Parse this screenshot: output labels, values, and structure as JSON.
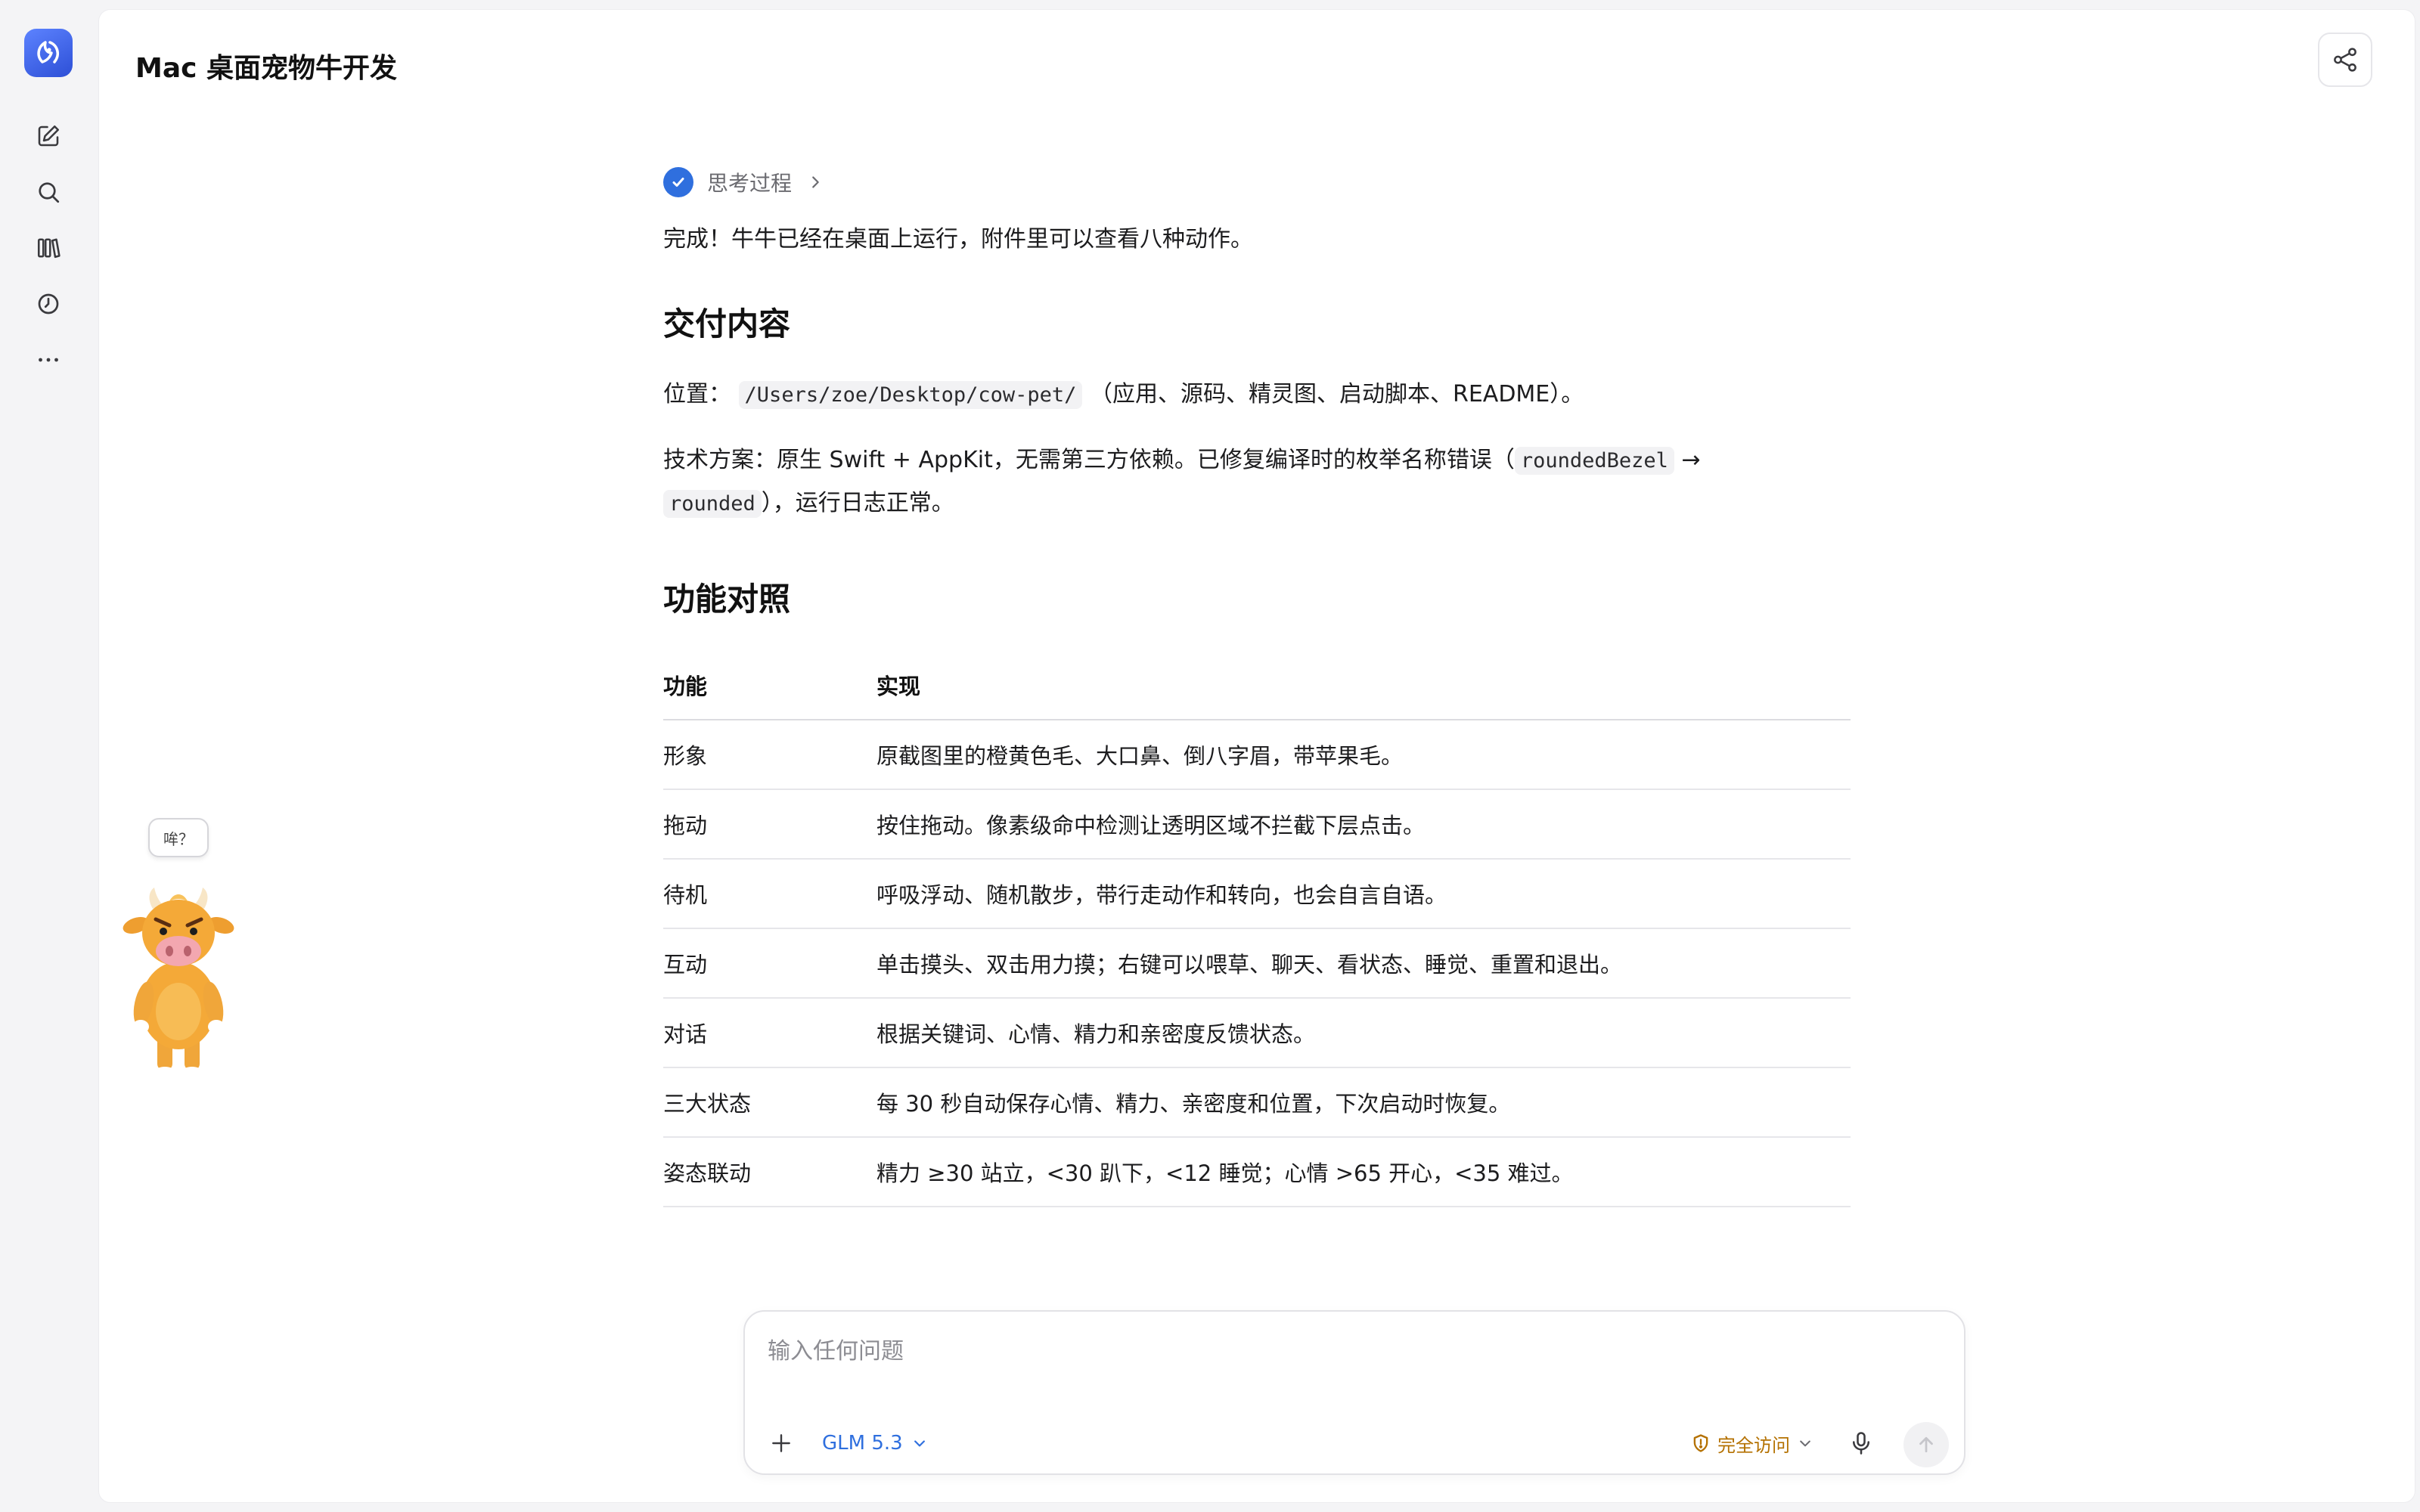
{
  "chat": {
    "title": "Mac 桌面宠物牛开发"
  },
  "sidebar": {
    "items": [
      {
        "icon": "edit-icon"
      },
      {
        "icon": "search-icon"
      },
      {
        "icon": "library-icon"
      },
      {
        "icon": "history-icon"
      },
      {
        "icon": "more-icon"
      }
    ]
  },
  "message": {
    "thinking_label": "思考过程",
    "intro": "完成！牛牛已经在桌面上运行，附件里可以查看八种动作。",
    "section1_title": "交付内容",
    "location_label": "位置：",
    "location_path": "/Users/zoe/Desktop/cow-pet/",
    "location_suffix": "（应用、源码、精灵图、启动脚本、README）。",
    "tech_text": "技术方案：原生 Swift + AppKit，无需第三方依赖。已修复编译时的枚举名称错误（",
    "tech_code1": "roundedBezel",
    "tech_arrow": " → ",
    "tech_code2": "rounded",
    "tech_suffix": "），运行日志正常。",
    "section2_title": "功能对照",
    "table": {
      "headers": [
        "功能",
        "实现"
      ],
      "rows": [
        [
          "形象",
          "原截图里的橙黄色毛、大口鼻、倒八字眉，带苹果毛。"
        ],
        [
          "拖动",
          "按住拖动。像素级命中检测让透明区域不拦截下层点击。"
        ],
        [
          "待机",
          "呼吸浮动、随机散步，带行走动作和转向，也会自言自语。"
        ],
        [
          "互动",
          "单击摸头、双击用力摸；右键可以喂草、聊天、看状态、睡觉、重置和退出。"
        ],
        [
          "对话",
          "根据关键词、心情、精力和亲密度反馈状态。"
        ],
        [
          "三大状态",
          "每 30 秒自动保存心情、精力、亲密度和位置，下次启动时恢复。"
        ],
        [
          "姿态联动",
          "精力 ≥30 站立，<30 趴下，<12 睡觉；心情 >65 开心，<35 难过。"
        ]
      ]
    }
  },
  "pet": {
    "bubble": "哞？"
  },
  "composer": {
    "placeholder": "输入任何问题",
    "model": "GLM 5.3",
    "access": "完全访问"
  },
  "colors": {
    "accent": "#2f6fde",
    "access": "#b47100",
    "pet_fur": "#f4a938"
  }
}
